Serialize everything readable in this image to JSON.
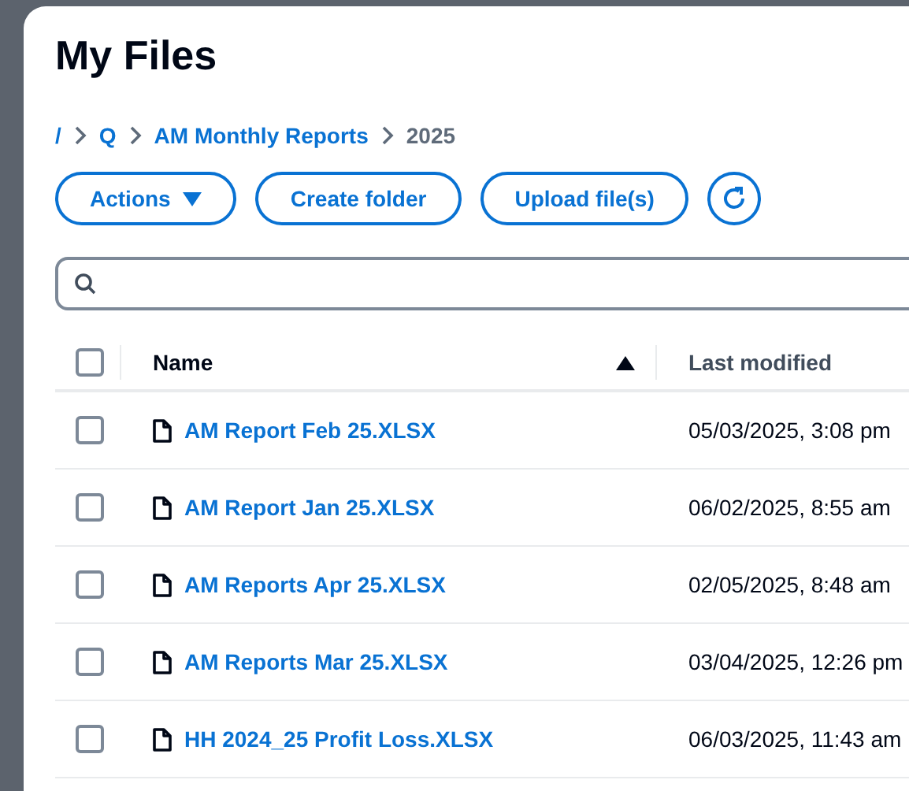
{
  "dialog": {
    "title": "My Files"
  },
  "breadcrumb": [
    {
      "label": "/",
      "current": false
    },
    {
      "label": "Q",
      "current": false
    },
    {
      "label": "AM Monthly Reports",
      "current": false
    },
    {
      "label": "2025",
      "current": true
    }
  ],
  "toolbar": [
    {
      "kind": "menu",
      "label": "Actions"
    },
    {
      "kind": "button",
      "label": "Create folder"
    },
    {
      "kind": "button",
      "label": "Upload file(s)"
    },
    {
      "kind": "refresh"
    }
  ],
  "table": {
    "select_all": {
      "checked": false
    },
    "columns": [
      {
        "label": "Name",
        "sorted": true
      },
      {
        "label": "Last modified",
        "sorted": false
      }
    ],
    "rows": [
      {
        "name": "AM Report Feb 25.XLSX",
        "modified": "05/03/2025, 3:08 pm",
        "selected": false
      },
      {
        "name": "AM Report Jan 25.XLSX",
        "modified": "06/02/2025, 8:55 am",
        "selected": false
      },
      {
        "name": "AM Reports Apr 25.XLSX",
        "modified": "02/05/2025, 8:48 am",
        "selected": false
      },
      {
        "name": "AM Reports Mar 25.XLSX",
        "modified": "03/04/2025, 12:26 pm",
        "selected": false
      },
      {
        "name": "HH 2024_25 Profit Loss.XLSX",
        "modified": "06/03/2025, 11:43 am",
        "selected": false
      }
    ]
  }
}
